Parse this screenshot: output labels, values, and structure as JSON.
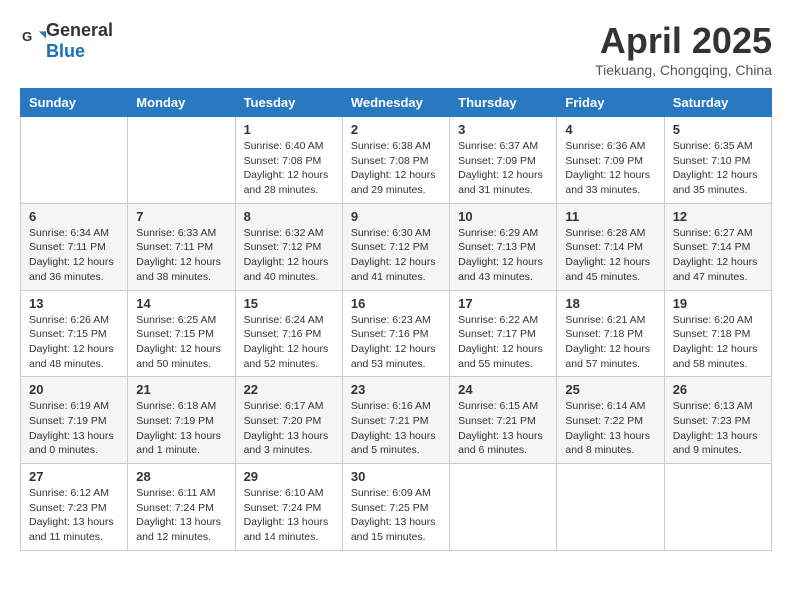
{
  "header": {
    "logo_general": "General",
    "logo_blue": "Blue",
    "title": "April 2025",
    "location": "Tiekuang, Chongqing, China"
  },
  "days_of_week": [
    "Sunday",
    "Monday",
    "Tuesday",
    "Wednesday",
    "Thursday",
    "Friday",
    "Saturday"
  ],
  "weeks": [
    [
      {
        "day": "",
        "content": ""
      },
      {
        "day": "",
        "content": ""
      },
      {
        "day": "1",
        "content": "Sunrise: 6:40 AM\nSunset: 7:08 PM\nDaylight: 12 hours and 28 minutes."
      },
      {
        "day": "2",
        "content": "Sunrise: 6:38 AM\nSunset: 7:08 PM\nDaylight: 12 hours and 29 minutes."
      },
      {
        "day": "3",
        "content": "Sunrise: 6:37 AM\nSunset: 7:09 PM\nDaylight: 12 hours and 31 minutes."
      },
      {
        "day": "4",
        "content": "Sunrise: 6:36 AM\nSunset: 7:09 PM\nDaylight: 12 hours and 33 minutes."
      },
      {
        "day": "5",
        "content": "Sunrise: 6:35 AM\nSunset: 7:10 PM\nDaylight: 12 hours and 35 minutes."
      }
    ],
    [
      {
        "day": "6",
        "content": "Sunrise: 6:34 AM\nSunset: 7:11 PM\nDaylight: 12 hours and 36 minutes."
      },
      {
        "day": "7",
        "content": "Sunrise: 6:33 AM\nSunset: 7:11 PM\nDaylight: 12 hours and 38 minutes."
      },
      {
        "day": "8",
        "content": "Sunrise: 6:32 AM\nSunset: 7:12 PM\nDaylight: 12 hours and 40 minutes."
      },
      {
        "day": "9",
        "content": "Sunrise: 6:30 AM\nSunset: 7:12 PM\nDaylight: 12 hours and 41 minutes."
      },
      {
        "day": "10",
        "content": "Sunrise: 6:29 AM\nSunset: 7:13 PM\nDaylight: 12 hours and 43 minutes."
      },
      {
        "day": "11",
        "content": "Sunrise: 6:28 AM\nSunset: 7:14 PM\nDaylight: 12 hours and 45 minutes."
      },
      {
        "day": "12",
        "content": "Sunrise: 6:27 AM\nSunset: 7:14 PM\nDaylight: 12 hours and 47 minutes."
      }
    ],
    [
      {
        "day": "13",
        "content": "Sunrise: 6:26 AM\nSunset: 7:15 PM\nDaylight: 12 hours and 48 minutes."
      },
      {
        "day": "14",
        "content": "Sunrise: 6:25 AM\nSunset: 7:15 PM\nDaylight: 12 hours and 50 minutes."
      },
      {
        "day": "15",
        "content": "Sunrise: 6:24 AM\nSunset: 7:16 PM\nDaylight: 12 hours and 52 minutes."
      },
      {
        "day": "16",
        "content": "Sunrise: 6:23 AM\nSunset: 7:16 PM\nDaylight: 12 hours and 53 minutes."
      },
      {
        "day": "17",
        "content": "Sunrise: 6:22 AM\nSunset: 7:17 PM\nDaylight: 12 hours and 55 minutes."
      },
      {
        "day": "18",
        "content": "Sunrise: 6:21 AM\nSunset: 7:18 PM\nDaylight: 12 hours and 57 minutes."
      },
      {
        "day": "19",
        "content": "Sunrise: 6:20 AM\nSunset: 7:18 PM\nDaylight: 12 hours and 58 minutes."
      }
    ],
    [
      {
        "day": "20",
        "content": "Sunrise: 6:19 AM\nSunset: 7:19 PM\nDaylight: 13 hours and 0 minutes."
      },
      {
        "day": "21",
        "content": "Sunrise: 6:18 AM\nSunset: 7:19 PM\nDaylight: 13 hours and 1 minute."
      },
      {
        "day": "22",
        "content": "Sunrise: 6:17 AM\nSunset: 7:20 PM\nDaylight: 13 hours and 3 minutes."
      },
      {
        "day": "23",
        "content": "Sunrise: 6:16 AM\nSunset: 7:21 PM\nDaylight: 13 hours and 5 minutes."
      },
      {
        "day": "24",
        "content": "Sunrise: 6:15 AM\nSunset: 7:21 PM\nDaylight: 13 hours and 6 minutes."
      },
      {
        "day": "25",
        "content": "Sunrise: 6:14 AM\nSunset: 7:22 PM\nDaylight: 13 hours and 8 minutes."
      },
      {
        "day": "26",
        "content": "Sunrise: 6:13 AM\nSunset: 7:23 PM\nDaylight: 13 hours and 9 minutes."
      }
    ],
    [
      {
        "day": "27",
        "content": "Sunrise: 6:12 AM\nSunset: 7:23 PM\nDaylight: 13 hours and 11 minutes."
      },
      {
        "day": "28",
        "content": "Sunrise: 6:11 AM\nSunset: 7:24 PM\nDaylight: 13 hours and 12 minutes."
      },
      {
        "day": "29",
        "content": "Sunrise: 6:10 AM\nSunset: 7:24 PM\nDaylight: 13 hours and 14 minutes."
      },
      {
        "day": "30",
        "content": "Sunrise: 6:09 AM\nSunset: 7:25 PM\nDaylight: 13 hours and 15 minutes."
      },
      {
        "day": "",
        "content": ""
      },
      {
        "day": "",
        "content": ""
      },
      {
        "day": "",
        "content": ""
      }
    ]
  ]
}
